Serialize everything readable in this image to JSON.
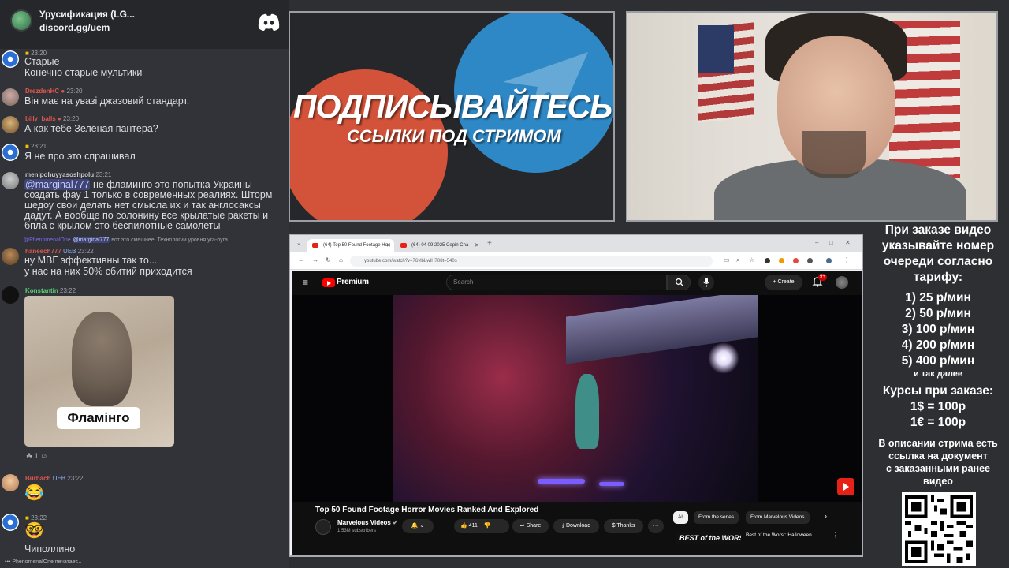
{
  "discord": {
    "server_name": "Урусификация (LG...",
    "invite": "discord.gg/uem",
    "messages": [
      {
        "time": "23:20",
        "lines": [
          "Старые",
          "Конечно старые мультики"
        ]
      },
      {
        "user": "DrezdenHC",
        "time": "23:20",
        "lines": [
          "Він має на увазі джазовий стандарт."
        ]
      },
      {
        "user": "billy_balls",
        "time": "23:20",
        "lines": [
          "А как тебе Зелёная пантера?"
        ]
      },
      {
        "time": "23:21",
        "lines": [
          "Я не про это спрашивал"
        ]
      },
      {
        "user": "menipohuyyasoshpolu",
        "time": "23:21",
        "mention": "@marginal777",
        "lines": [
          " не фламинго это попытка Украины",
          "создать фау 1 только в современных реалиях. Шторм",
          "шедоу свои делать нет смысла их и так англосаксы",
          "дадут. А вообще по солонину все крылатые ракеты и",
          "бпла с крылом это беспилотные самолеты"
        ]
      },
      {
        "reply_user": "@PhenomenalOne",
        "reply_mention": "@marginal777",
        "reply_text": "вот это смешнее. Технологии уровня уга-буга",
        "user": "haneech777",
        "badge": "UEB",
        "time": "23:22",
        "lines": [
          "ну МВГ эффективны так то...",
          "у нас на них 50% сбитий приходится"
        ]
      },
      {
        "user": "Konstantin",
        "time": "23:22",
        "gif_caption": "Фламінго",
        "reaction_count": "1"
      },
      {
        "user": "Burbach",
        "badge": "UEB",
        "time": "23:22",
        "lines": [
          "😂"
        ]
      },
      {
        "time": "23:22",
        "lines": [
          "🤓",
          "Чиполлино"
        ]
      }
    ],
    "typing": "PhenomenalOne печатает..."
  },
  "banner": {
    "title": "ПОДПИСЫВАЙТЕСЬ",
    "subtitle": "ССЫЛКИ ПОД СТРИМОМ",
    "colors": {
      "blue": "#2f88c6",
      "orange": "#d2533a"
    }
  },
  "browser": {
    "tabs": [
      "(64) Top 50 Found Footage Ho",
      "(64) 04 09 2025 Серія Cha"
    ],
    "url": "youtube.com/watch?v=76ylbLwIH708t=540s"
  },
  "youtube": {
    "logo": "Premium",
    "search_placeholder": "Search",
    "create_label": "Create",
    "notification_badge": "9+",
    "video_title": "Top 50 Found Footage Horror Movies Ranked And Explored",
    "channel": "Marvelous Videos",
    "subscribers": "1.53M subscribers",
    "likes": "411",
    "share": "Share",
    "download": "Download",
    "thanks": "Thanks",
    "more": "···",
    "chips": [
      "All",
      "From the series",
      "From Marvelous Videos"
    ],
    "recommended_thumb": "BEST of the WORST",
    "recommended_title": "Best of the Worst: Halloween",
    "subscribe_icon": "subscribe-icon"
  },
  "pricing": {
    "heading": [
      "При заказе видео",
      "указывайте номер",
      "очереди согласно",
      "тарифу:"
    ],
    "tiers": [
      "1) 25 р/мин",
      "2) 50 р/мин",
      "3) 100 р/мин",
      "4) 200 р/мин",
      "5) 400 р/мин"
    ],
    "etc": "и так далее",
    "rates_heading": "Курсы при заказе:",
    "rates": [
      "1$ = 100р",
      "1€ = 100р"
    ],
    "note": [
      "В описании стрима есть",
      "ссылка на документ",
      "с заказанными ранее",
      "видео"
    ]
  }
}
